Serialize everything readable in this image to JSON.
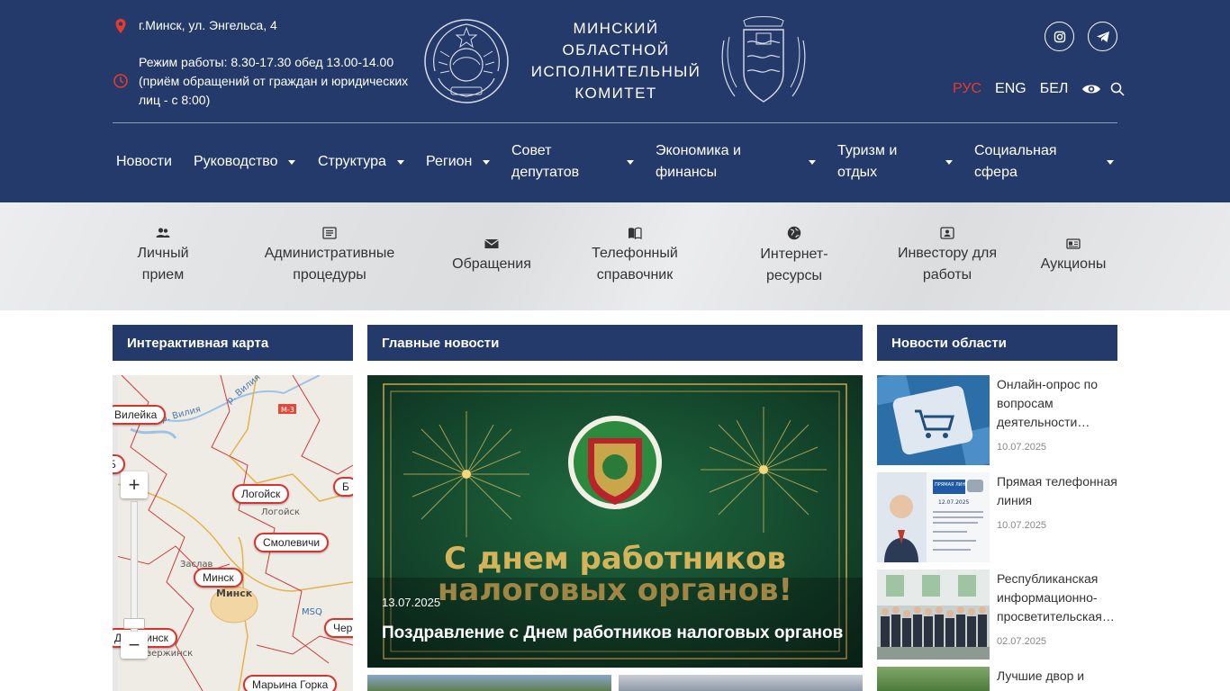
{
  "header": {
    "address": "г.Минск, ул. Энгельса, 4",
    "hours": "Режим работы: 8.30-17.30 обед 13.00-14.00 (приём обращений от граждан и юридических лиц - с 8:00)",
    "org_title": "МИНСКИЙ ОБЛАСТНОЙ ИСПОЛНИТЕЛЬНЫЙ КОМИТЕТ",
    "emblem_left_text": "РЭСПУБЛIКА БЕЛАРУСЬ",
    "languages": [
      "РУС",
      "ENG",
      "БЕЛ"
    ],
    "active_language": "РУС",
    "accent_color": "#e63a2e",
    "brand_color": "#233a6b"
  },
  "nav": {
    "items": [
      {
        "label": "Новости"
      },
      {
        "label": "Руководство"
      },
      {
        "label": "Структура"
      },
      {
        "label": "Регион"
      },
      {
        "label": "Совет депутатов"
      },
      {
        "label": "Экономика и финансы"
      },
      {
        "label": "Туризм и отдых"
      },
      {
        "label": "Социальная сфера"
      }
    ]
  },
  "quick_links": [
    {
      "label": "Личный прием",
      "icon": "users-icon"
    },
    {
      "label": "Административные процедуры",
      "icon": "list-icon"
    },
    {
      "label": "Обращения",
      "icon": "envelope-icon"
    },
    {
      "label": "Телефонный справочник",
      "icon": "book-icon"
    },
    {
      "label": "Интернет-ресурсы",
      "icon": "globe-icon"
    },
    {
      "label": "Инвестору для работы",
      "icon": "investor-icon"
    },
    {
      "label": "Аукционы",
      "icon": "auction-icon"
    }
  ],
  "columns": {
    "map_title": "Интерактивная карта",
    "main_news_title": "Главные новости",
    "region_news_title": "Новости области"
  },
  "map": {
    "labels": [
      "Логойск",
      "Смолевичи",
      "Минск",
      "Марьина Горка"
    ],
    "towns": [
      "р. Вилия",
      "р. Вилия",
      "М-3",
      "Логойск",
      "Заслав",
      "Минск",
      "MSQ",
      "Дзержинск"
    ],
    "zoom_in": "+",
    "zoom_out": "−"
  },
  "main_news": {
    "banner_line1": "С днем работников",
    "banner_line2": "налоговых органов!",
    "date": "13.07.2025",
    "title": "Поздравление с Днем работников налоговых органов"
  },
  "region_news": [
    {
      "title": "Онлайн-опрос по вопросам деятельности…",
      "date": "10.07.2025"
    },
    {
      "title": "Прямая телефонная линия",
      "date": "10.07.2025",
      "img_heading": "ПРЯМАЯ ЛИНИЯ",
      "img_date": "12.07.2025"
    },
    {
      "title": "Республиканская информационно-просветительская…",
      "date": "02.07.2025"
    },
    {
      "title": "Лучшие двор и",
      "date": ""
    }
  ]
}
